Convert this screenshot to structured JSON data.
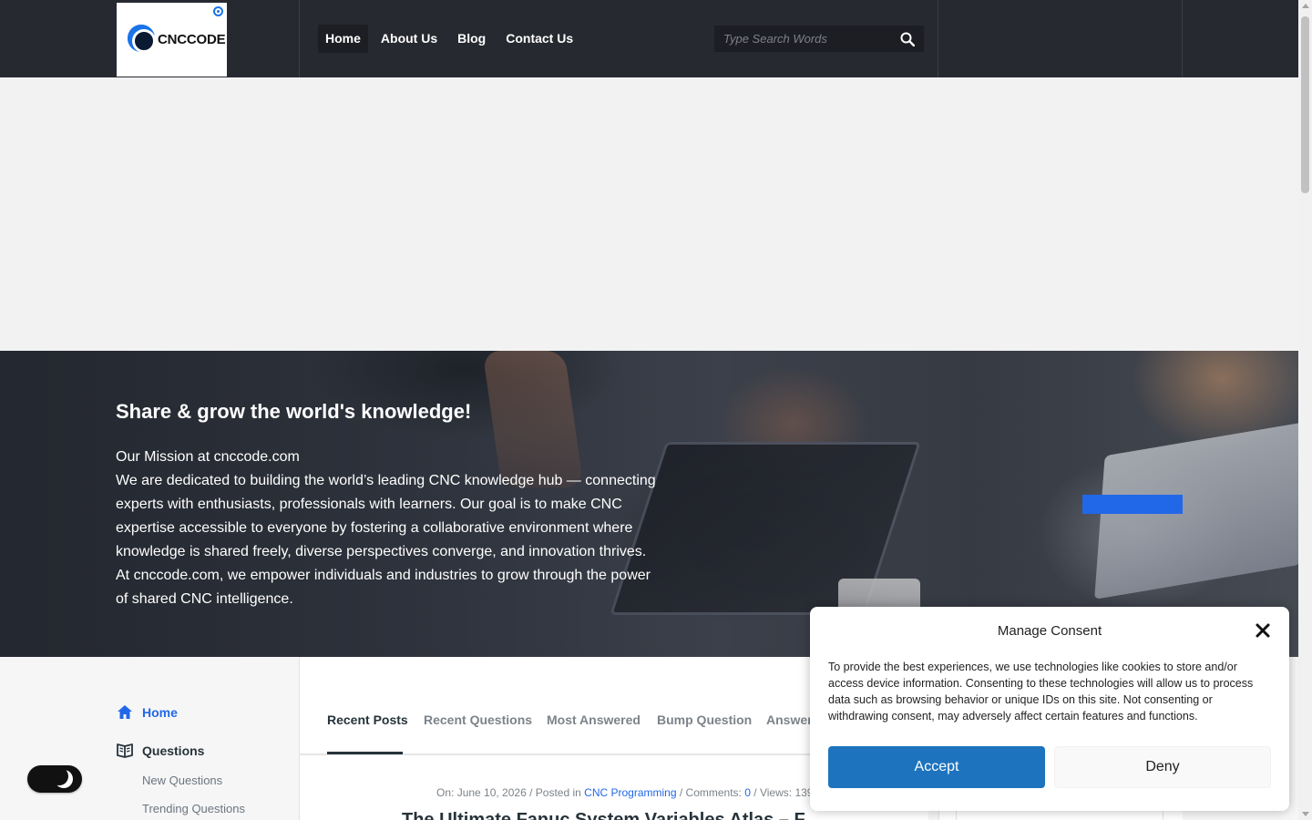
{
  "header": {
    "logo_text": "CNCCODE",
    "nav": [
      {
        "label": "Home",
        "active": true
      },
      {
        "label": "About Us",
        "active": false
      },
      {
        "label": "Blog",
        "active": false
      },
      {
        "label": "Contact Us",
        "active": false
      }
    ],
    "search": {
      "placeholder": "Type Search Words",
      "icon": "search-icon"
    }
  },
  "hero": {
    "title": "Share & grow the world's knowledge!",
    "mission_heading": "Our Mission at cnccode.com",
    "mission_text": "We are dedicated to building the world’s leading CNC knowledge hub — connecting experts with enthusiasts, professionals with learners. Our goal is to make CNC expertise accessible to everyone by fostering a collaborative environment where knowledge is shared freely, diverse perspectives converge, and innovation thrives. At cnccode.com, we empower individuals and industries to grow through the power of shared CNC intelligence.",
    "accent_color": "#2168e8"
  },
  "sidebar": {
    "items": [
      {
        "label": "Home",
        "icon": "home-icon",
        "active": true
      },
      {
        "label": "Questions",
        "icon": "book-icon",
        "active": false
      }
    ],
    "sub_items": [
      "New Questions",
      "Trending Questions"
    ]
  },
  "tabs": [
    {
      "label": "Recent Posts",
      "active": true
    },
    {
      "label": "Recent Questions",
      "active": false
    },
    {
      "label": "Most Answered",
      "active": false
    },
    {
      "label": "Bump Question",
      "active": false
    },
    {
      "label": "Answer",
      "active": false
    }
  ],
  "post": {
    "on_label": "On:",
    "date": "June 10, 2026",
    "posted_in_label": "Posted in",
    "category": "CNC Programming",
    "comments_label": "Comments:",
    "comments": "0",
    "views_label": "Views:",
    "views": "139",
    "title": "The Ultimate Fanuc System Variables Atlas – F"
  },
  "consent": {
    "title": "Manage Consent",
    "text": "To provide the best experiences, we use technologies like cookies to store and/or access device information. Consenting to these technologies will allow us to process data such as browsing behavior or unique IDs on this site. Not consenting or withdrawing consent, may adversely affect certain features and functions.",
    "accept_label": "Accept",
    "deny_label": "Deny",
    "accept_color": "#1e73be"
  }
}
